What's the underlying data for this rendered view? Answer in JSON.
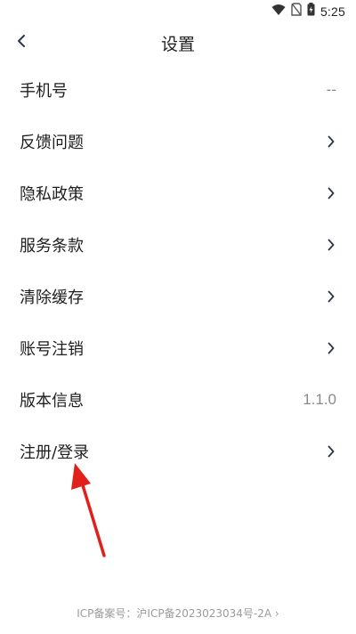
{
  "status_bar": {
    "time": "5:25",
    "icons": [
      "wifi-icon",
      "no-sim-icon",
      "battery-charging-icon"
    ]
  },
  "header": {
    "back_icon": "chevron-left-icon",
    "title": "设置"
  },
  "settings": {
    "items": [
      {
        "label": "手机号",
        "value": "--",
        "trailing": "value"
      },
      {
        "label": "反馈问题",
        "trailing": "chevron"
      },
      {
        "label": "隐私政策",
        "trailing": "chevron"
      },
      {
        "label": "服务条款",
        "trailing": "chevron"
      },
      {
        "label": "清除缓存",
        "trailing": "chevron"
      },
      {
        "label": "账号注销",
        "trailing": "chevron"
      },
      {
        "label": "版本信息",
        "value": "1.1.0",
        "trailing": "value"
      },
      {
        "label": "注册/登录",
        "trailing": "chevron"
      }
    ]
  },
  "footer": {
    "icp_text": "ICP备案号：沪ICP备2023023034号-2A",
    "icp_chevron": "›"
  },
  "colors": {
    "chevron": "#2a3550",
    "value_text": "#8a8a8a",
    "annotation_arrow": "#e0201b"
  }
}
